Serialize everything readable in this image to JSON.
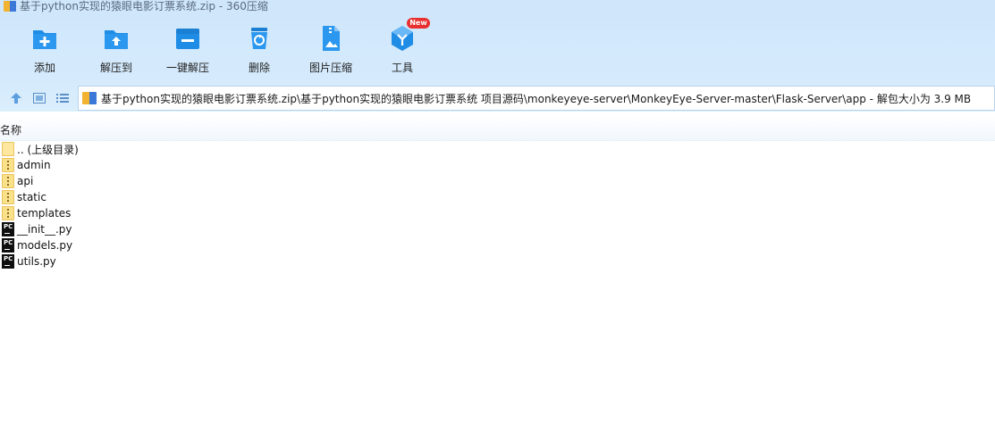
{
  "window": {
    "title": "基于python实现的猿眼电影订票系统.zip - 360压缩"
  },
  "toolbar": {
    "items": [
      {
        "label": "添加",
        "icon": "add-icon"
      },
      {
        "label": "解压到",
        "icon": "extract-to-icon"
      },
      {
        "label": "一键解压",
        "icon": "one-click-extract-icon"
      },
      {
        "label": "删除",
        "icon": "delete-icon"
      },
      {
        "label": "图片压缩",
        "icon": "image-compress-icon"
      },
      {
        "label": "工具",
        "icon": "tools-icon",
        "badge": "New"
      }
    ]
  },
  "nav": {
    "address": "基于python实现的猿眼电影订票系统.zip\\基于python实现的猿眼电影订票系统 项目源码\\monkeyeye-server\\MonkeyEye-Server-master\\Flask-Server\\app - 解包大小为 3.9 MB"
  },
  "list": {
    "column_name": "名称",
    "items": [
      {
        "name": ".. (上级目录)",
        "type": "parent"
      },
      {
        "name": "admin",
        "type": "folder"
      },
      {
        "name": "api",
        "type": "folder"
      },
      {
        "name": "static",
        "type": "folder"
      },
      {
        "name": "templates",
        "type": "folder"
      },
      {
        "name": "__init__.py",
        "type": "pyfile"
      },
      {
        "name": "models.py",
        "type": "pyfile"
      },
      {
        "name": "utils.py",
        "type": "pyfile"
      }
    ]
  },
  "colors": {
    "accent": "#1f8ce6",
    "toolbar_bg": "#d6ebfc",
    "badge": "#e8302e"
  }
}
